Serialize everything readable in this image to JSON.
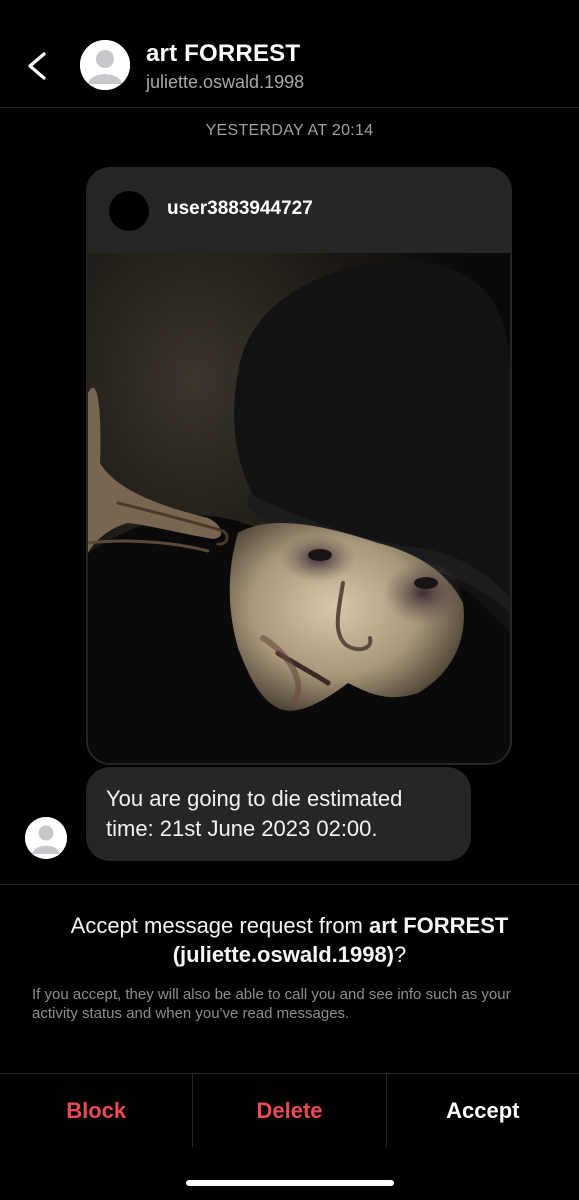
{
  "header": {
    "name": "art FORREST",
    "handle": "juliette.oswald.1998",
    "back_icon": "chevron-left-icon",
    "avatar_icon": "default-avatar-icon"
  },
  "conversation": {
    "timestamp": "YESTERDAY AT 20:14",
    "shared_post": {
      "username": "user3883944727",
      "image": "photo-person-in-black-beanie-with-pale-face-makeup"
    },
    "message": {
      "text": "You are going to die estimated time: 21st June 2023 02:00."
    }
  },
  "request": {
    "title_prefix": "Accept message request from ",
    "title_name": "art FORREST",
    "title_handle": "(juliette.oswald.1998)",
    "title_suffix": "?",
    "description": "If you accept, they will also be able to call you and see info such as your activity status and when you've read messages."
  },
  "actions": {
    "block": "Block",
    "delete": "Delete",
    "accept": "Accept"
  },
  "colors": {
    "background": "#000000",
    "bubble": "#262626",
    "danger": "#ed4956",
    "muted": "#a8a8a8"
  }
}
